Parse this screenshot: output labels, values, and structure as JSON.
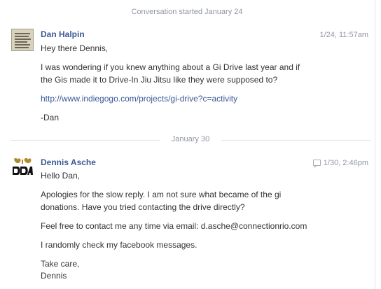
{
  "thread": {
    "started_label": "Conversation started January 24",
    "date_divider": "January 30"
  },
  "messages": [
    {
      "sender": "Dan Halpin",
      "timestamp": "1/24, 11:57am",
      "avatar_icon": "profile-photo-icon",
      "paragraphs": [
        {
          "lines": [
            "Hey there Dennis,"
          ]
        },
        {
          "lines": [
            "I was wondering if you knew anything about a Gi Drive last year and if",
            "the Gis made it to Drive-In Jiu Jitsu like they were supposed to?"
          ]
        },
        {
          "lines": [
            "http://www.indiegogo.com/projects/gi-drive?c=activity"
          ]
        },
        {
          "lines": [
            "-Dan"
          ]
        }
      ]
    },
    {
      "sender": "Dennis Asche",
      "timestamp": "1/30, 2:46pm",
      "timestamp_icon": "reply-icon",
      "avatar_icon": "profile-logo-icon",
      "paragraphs": [
        {
          "lines": [
            "Hello Dan,"
          ]
        },
        {
          "lines": [
            "Apologies for the slow reply. I am not sure what became of the gi",
            "donations. Have you tried contacting the drive directly?"
          ]
        },
        {
          "lines": [
            "Feel free to contact me any time via email: d.asche@connectionrio.com"
          ]
        },
        {
          "lines": [
            "I randomly check my facebook messages."
          ]
        },
        {
          "lines": [
            "Take care,",
            "Dennis"
          ]
        }
      ]
    }
  ],
  "colors": {
    "link": "#3b5998",
    "meta": "#9197a3",
    "text": "#333333"
  }
}
